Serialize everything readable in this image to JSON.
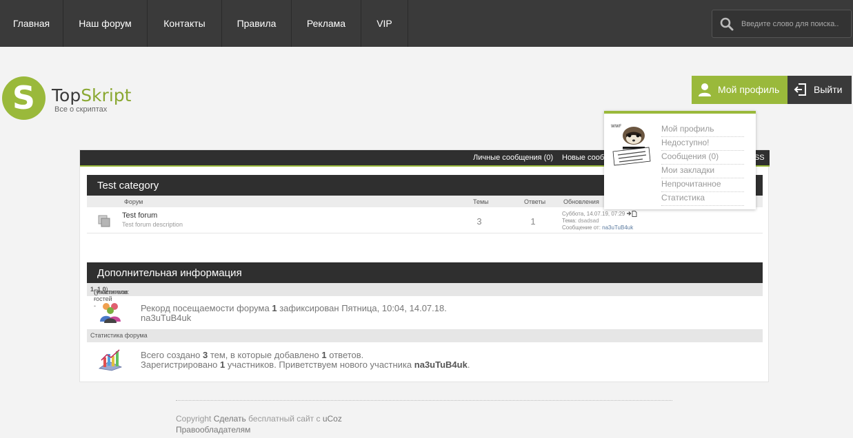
{
  "nav": {
    "items": [
      "Главная",
      "Наш форум",
      "Контакты",
      "Правила",
      "Реклама",
      "VIP"
    ]
  },
  "search": {
    "placeholder": "Введите слово для поиска.."
  },
  "logo": {
    "letter": "S",
    "title_part1": "Top",
    "title_part2": "Skript",
    "subtitle": "Все о скриптах"
  },
  "profile": {
    "my_profile": "Мой профиль",
    "logout": "Выйти"
  },
  "dropdown": {
    "items": [
      "Мой профиль",
      "Недоступно!",
      "Сообщения (0)",
      "Мои закладки",
      "Непрочитанное",
      "Статистика"
    ]
  },
  "userbar": {
    "messages": "Личные сообщения (0)",
    "new_messages": "Новые сообщения",
    "rss": "RSS"
  },
  "category": {
    "title": "Test category",
    "columns": {
      "forum": "Форум",
      "topics": "Темы",
      "replies": "Ответы",
      "updates": "Обновления"
    },
    "forums": [
      {
        "name": "Test forum",
        "description": "Test forum description",
        "topics": "3",
        "replies": "1",
        "last_date": "Суббота, 14.07.19, 07:29",
        "last_topic_label": "Тема:",
        "last_topic": "dsadsad",
        "last_author_label": "Сообщение от:",
        "last_author": "na3uTuB4uk"
      }
    ]
  },
  "info": {
    "title": "Дополнительная информация",
    "visitors_label": "Посетители:",
    "visitors_count": "1",
    "members_label": "(участников -",
    "members_count": "1",
    "guests_label": ", гостей -",
    "guests_count": "0",
    "record_pre": "Рекорд посещаемости форума",
    "record_count": "1",
    "record_post": "зафиксирован Пятница, 10:04, 14.07.18.",
    "record_user": "na3uTuB4uk",
    "stats_label": "Статистика форума",
    "stats_pre": "Всего создано",
    "stats_topics": "3",
    "stats_mid": "тем, в которые добавлено",
    "stats_replies": "1",
    "stats_post": "ответов.",
    "reg_pre": "Зарегистрировано",
    "reg_count": "1",
    "reg_mid": "участников. Приветствуем нового участника",
    "reg_user": "na3uTuB4uk"
  },
  "footer": {
    "copyright": "Copyright",
    "make_site": "Сделать",
    "free_site": "бесплатный сайт с",
    "ucoz": "uCoz",
    "rights": "Правообладателям"
  },
  "colors": {
    "accent": "#9ab93b",
    "dark": "#2f2f2f",
    "nav": "#3a3a3a"
  }
}
